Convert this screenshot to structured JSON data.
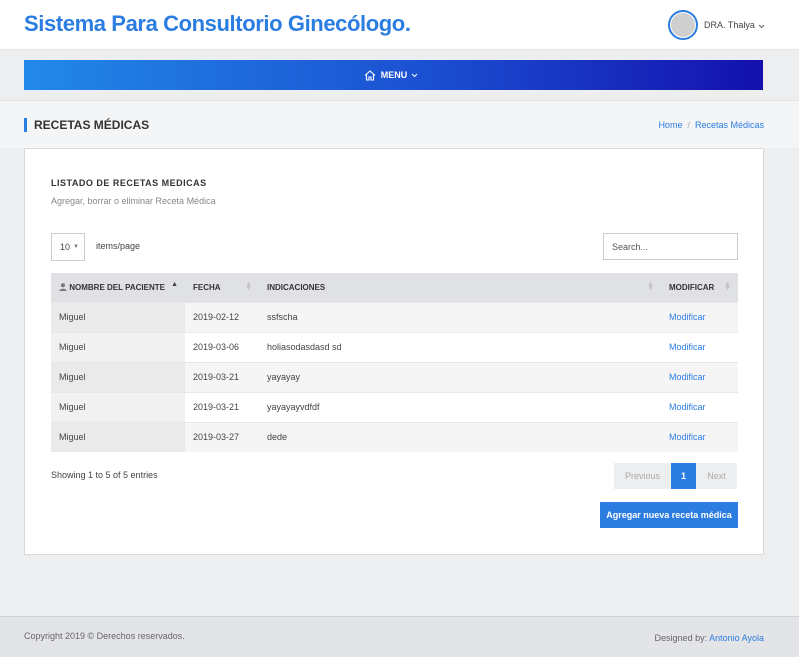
{
  "header": {
    "app_title": "Sistema Para Consultorio Ginecólogo.",
    "user_name": "DRA. Thalya"
  },
  "navbar": {
    "menu_label": "MENU",
    "icons": {
      "menu": "home-icon",
      "dropdown": "chevron-down-icon"
    }
  },
  "page": {
    "title": "RECETAS MÉDICAS",
    "breadcrumb": [
      "Home",
      "Recetas Médicas"
    ]
  },
  "card": {
    "title": "LISTADO DE RECETAS MEDICAS",
    "subtitle": "Agregar, borrar o eliminar Receta Médica"
  },
  "controls": {
    "page_length": "10",
    "page_length_label": "items/page",
    "search_placeholder": "Search..."
  },
  "table": {
    "columns": [
      "NOMBRE DEL PACIENTE",
      "FECHA",
      "INDICACIONES",
      "MODIFICAR"
    ],
    "rows": [
      {
        "nombre": "Miguel",
        "fecha": "2019-02-12",
        "indicaciones": "ssfscha",
        "accion": "Modificar"
      },
      {
        "nombre": "Miguel",
        "fecha": "2019-03-06",
        "indicaciones": "holiasodasdasd sd",
        "accion": "Modificar"
      },
      {
        "nombre": "Miguel",
        "fecha": "2019-03-21",
        "indicaciones": "yayayay",
        "accion": "Modificar"
      },
      {
        "nombre": "Miguel",
        "fecha": "2019-03-21",
        "indicaciones": "yayayayvdfdf",
        "accion": "Modificar"
      },
      {
        "nombre": "Miguel",
        "fecha": "2019-03-27",
        "indicaciones": "dede",
        "accion": "Modificar"
      }
    ]
  },
  "pagination": {
    "info": "Showing 1 to 5 of 5 entries",
    "previous": "Previous",
    "current": "1",
    "next": "Next"
  },
  "actions": {
    "add_label": "Agregar nueva receta médica"
  },
  "footer": {
    "copyright": "Copyright 2019 © Derechos reservados.",
    "designed_by_label": "Designed by:",
    "designer": "Antonio Ayola"
  },
  "colors": {
    "accent": "#2b7de1",
    "nav_gradient_start": "#2289e8",
    "nav_gradient_end": "#1410ae"
  }
}
